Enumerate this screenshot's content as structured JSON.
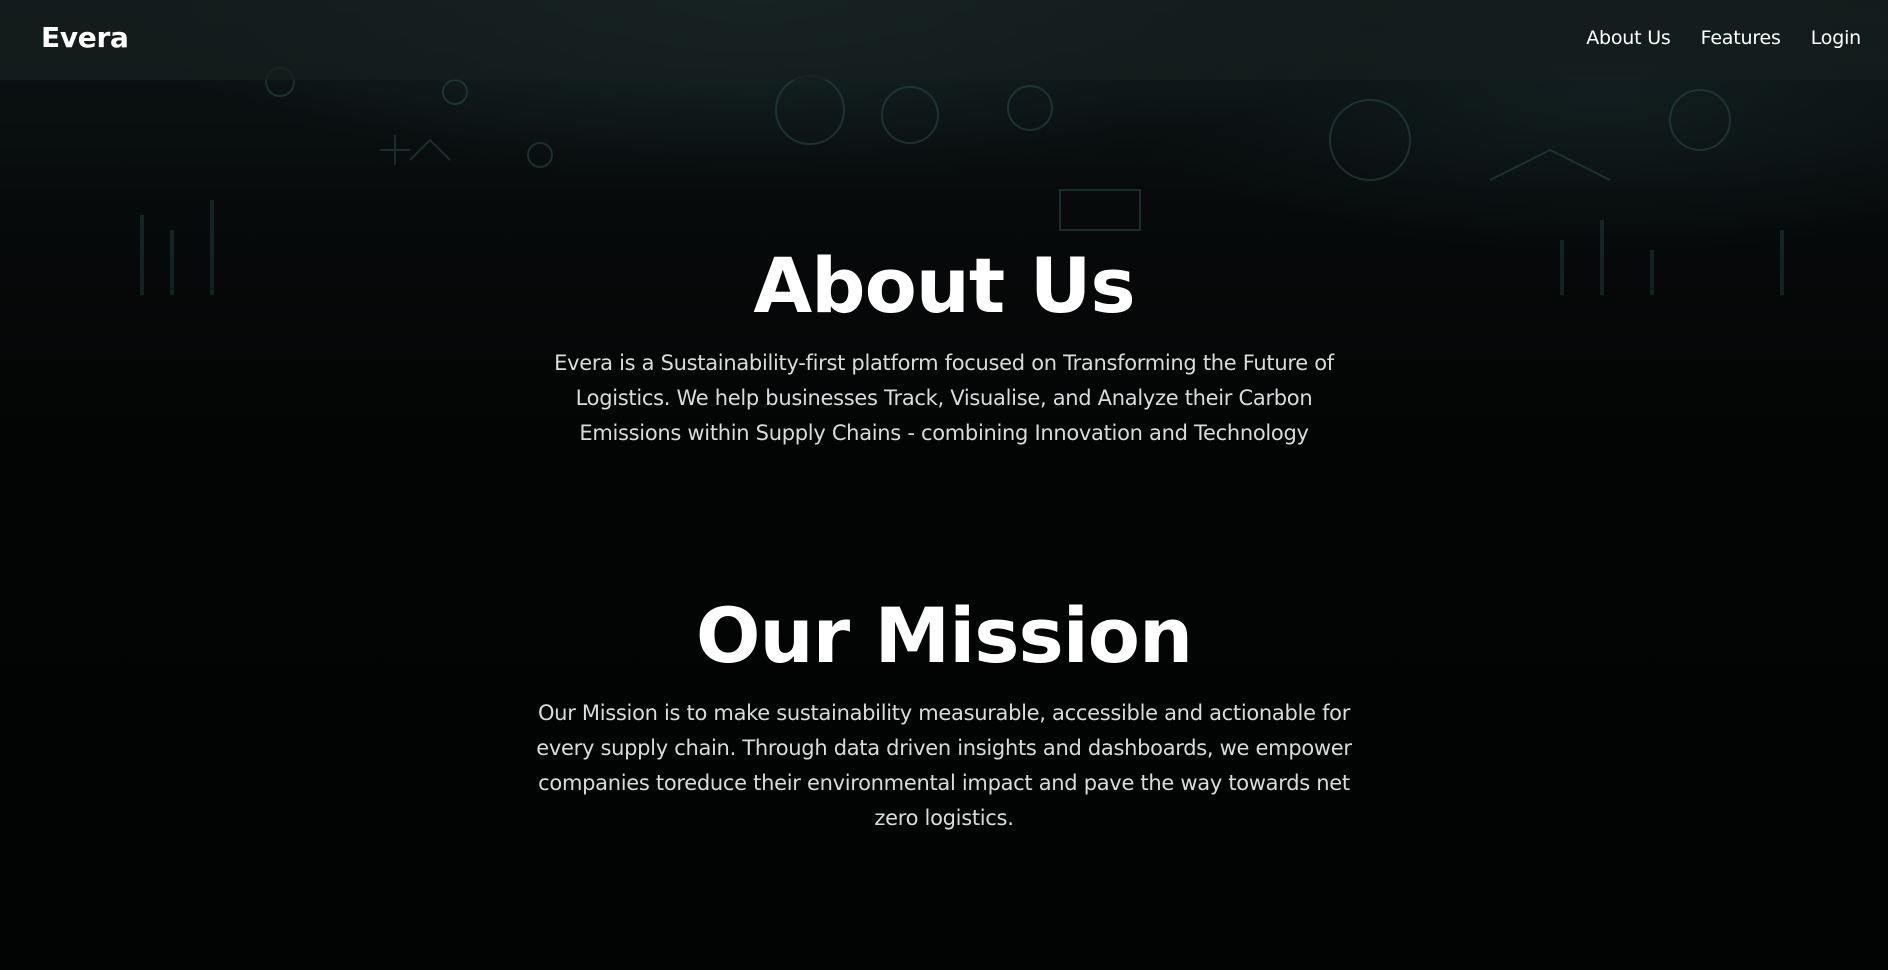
{
  "nav": {
    "brand": "Evera",
    "links": [
      "About Us",
      "Features",
      "Login"
    ]
  },
  "about": {
    "title": "About Us",
    "body": "Evera is a Sustainability-first platform focused on Transforming the Future of Logistics. We help businesses Track, Visualise, and Analyze their Carbon Emissions within Supply Chains - combining Innovation and Technology"
  },
  "mission": {
    "title": "Our Mission",
    "body": "Our Mission is to make sustainability measurable, accessible and actionable for every supply chain. Through data driven insights and dashboards, we empower companies toreduce their environmental impact and pave the way towards net zero logistics."
  },
  "colors": {
    "background": "#030404",
    "navbar": "#161e1f",
    "text": "#ffffff",
    "body_text": "#d9dcdc"
  }
}
